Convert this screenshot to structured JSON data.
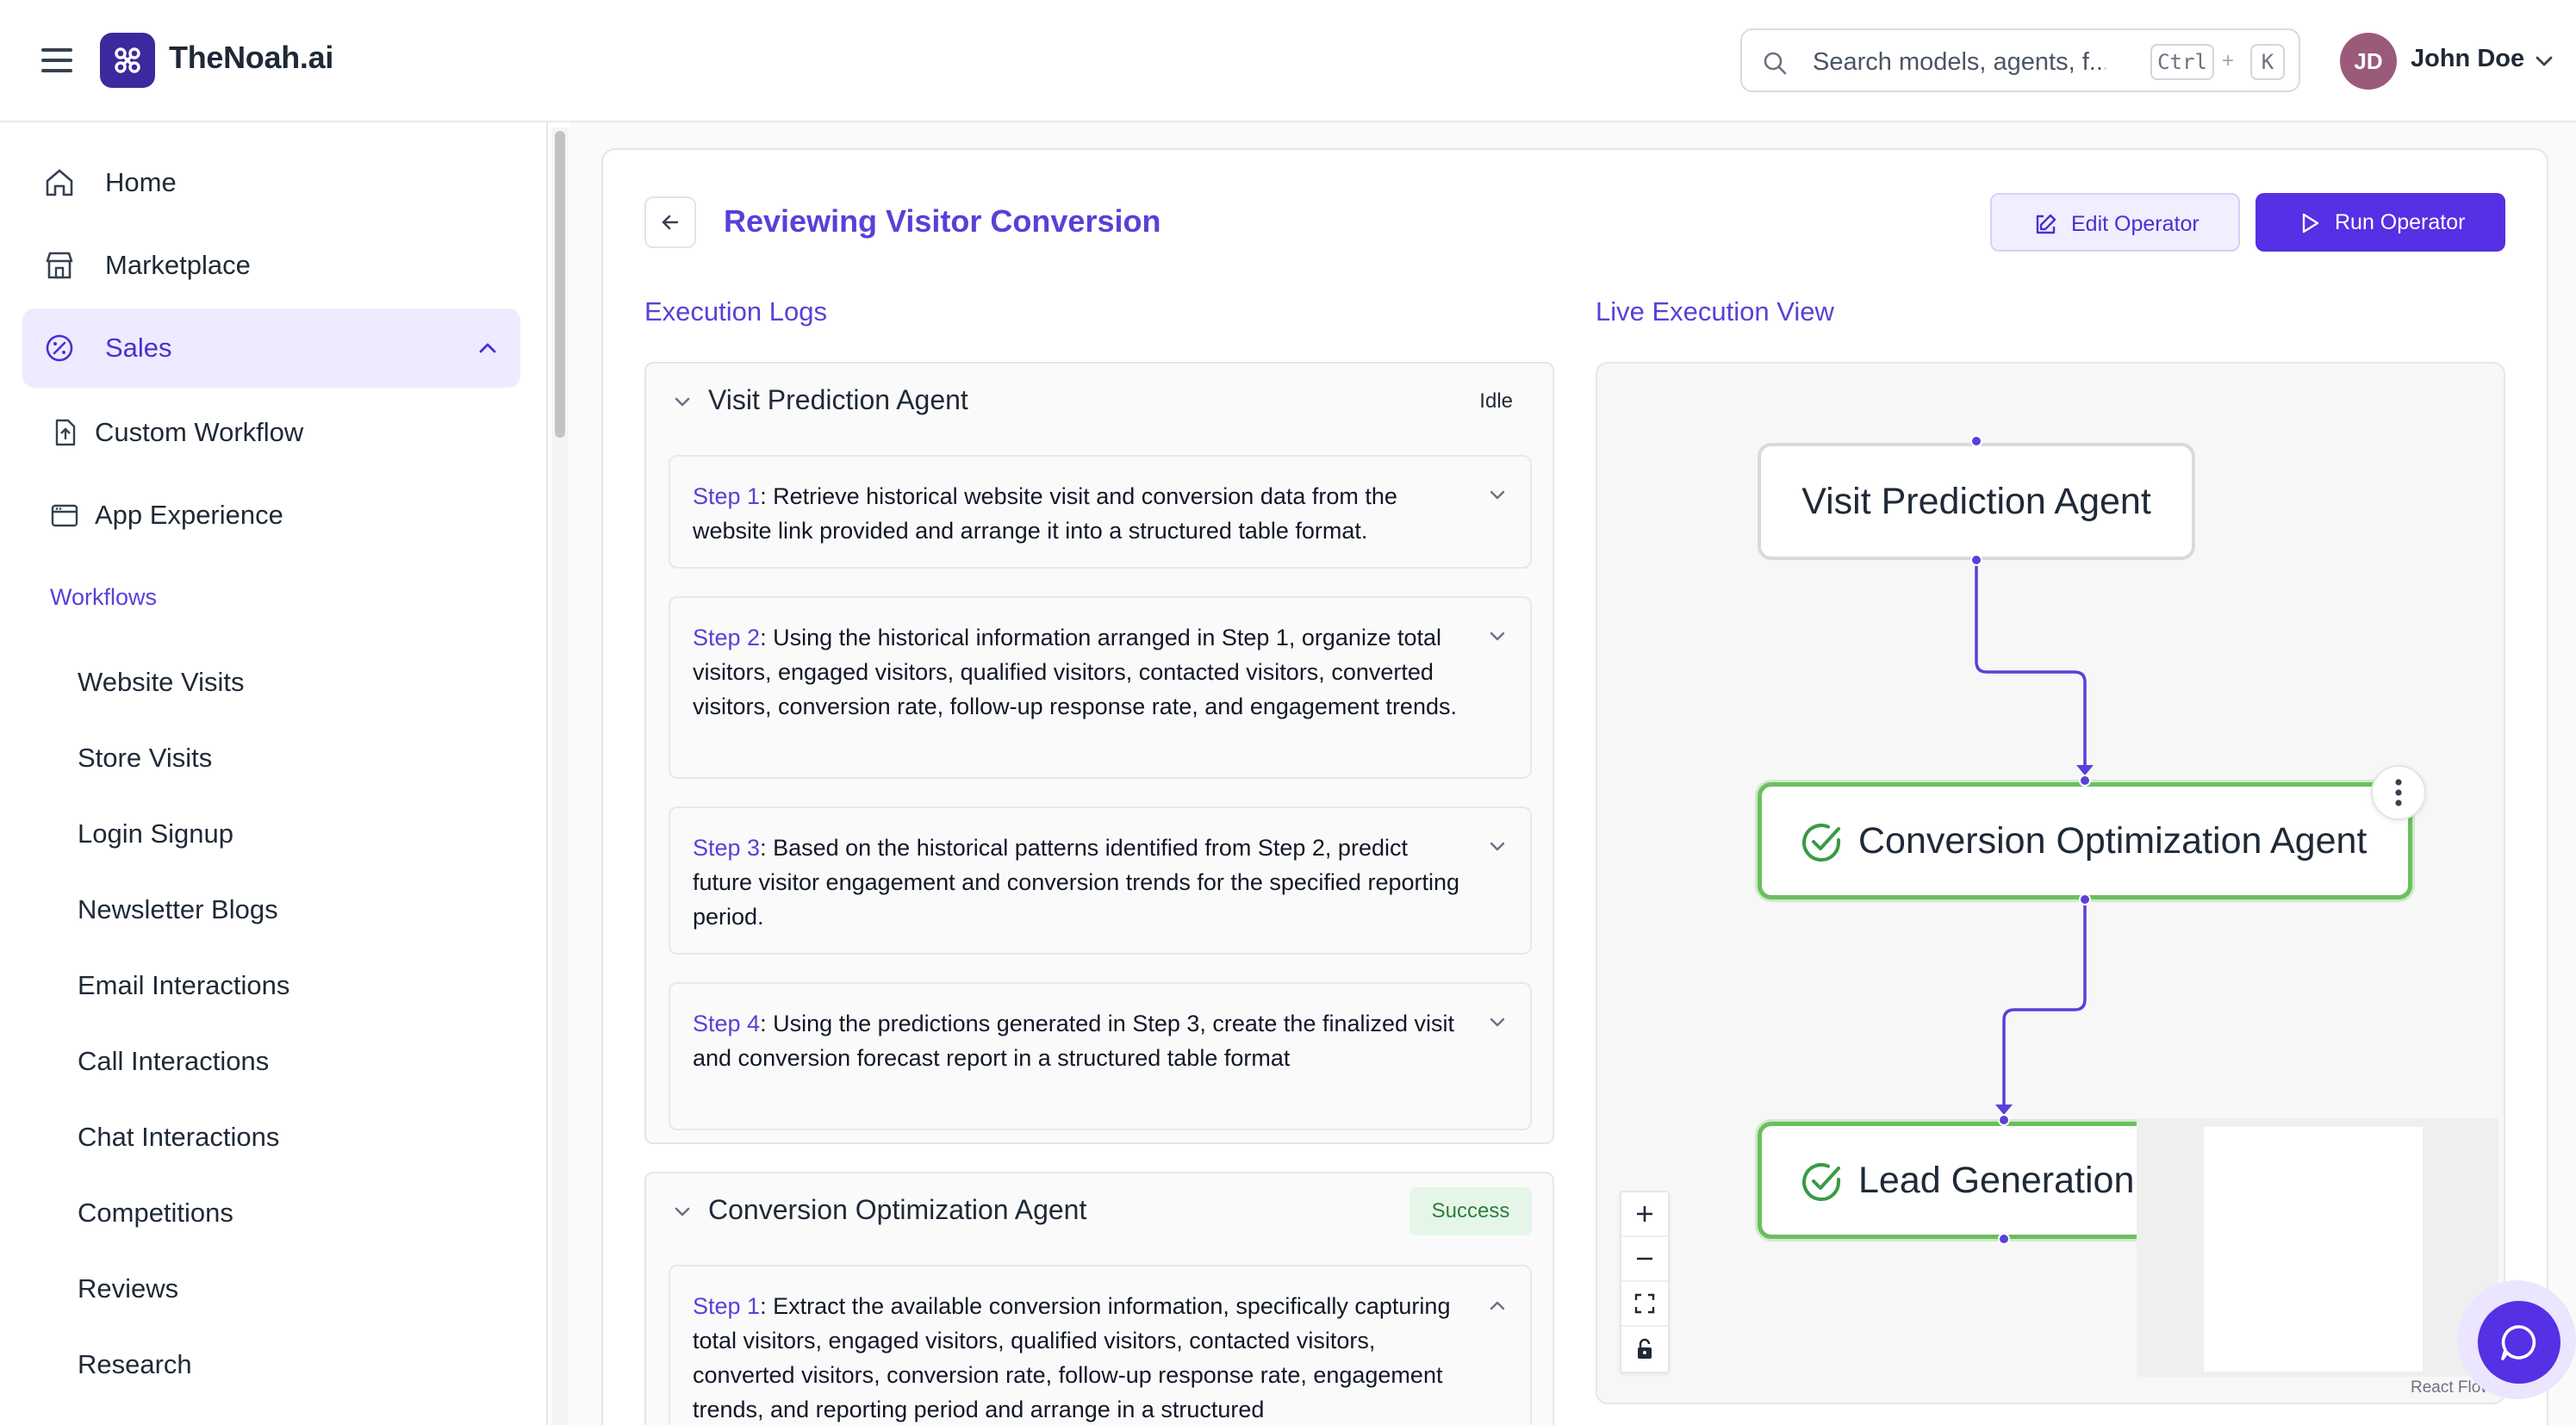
{
  "header": {
    "brand": "TheNoah.ai",
    "search_placeholder": "Search models, agents, f...",
    "shortcut_ctrl": "Ctrl",
    "shortcut_plus": "+",
    "shortcut_key": "K",
    "user_initials": "JD",
    "user_name": "John Doe"
  },
  "sidebar": {
    "items": [
      {
        "label": "Home",
        "icon": "home-icon"
      },
      {
        "label": "Marketplace",
        "icon": "store-icon"
      },
      {
        "label": "Sales",
        "icon": "sales-icon",
        "active": true,
        "expanded": true
      },
      {
        "label": "Custom Workflow",
        "icon": "file-upload-icon"
      },
      {
        "label": "App Experience",
        "icon": "browser-window-icon"
      }
    ],
    "section_title": "Workflows",
    "workflows": [
      "Website Visits",
      "Store Visits",
      "Login Signup",
      "Newsletter Blogs",
      "Email Interactions",
      "Call Interactions",
      "Chat Interactions",
      "Competitions",
      "Reviews",
      "Research"
    ]
  },
  "page": {
    "title": "Reviewing Visitor Conversion",
    "edit_label": "Edit Operator",
    "run_label": "Run Operator",
    "logs_title": "Execution Logs",
    "live_title": "Live Execution View"
  },
  "logs": [
    {
      "agent": "Visit Prediction Agent",
      "status": "Idle",
      "steps": [
        {
          "label": "Step 1",
          "text": ": Retrieve historical website visit and conversion data from the website link provided and arrange it into a structured table format."
        },
        {
          "label": "Step 2",
          "text": ": Using the historical information arranged in Step 1, organize total visitors, engaged visitors, qualified visitors, contacted visitors, converted visitors, conversion rate, follow-up response rate, and engagement trends."
        },
        {
          "label": "Step 3",
          "text": ": Based on the historical patterns identified from Step 2, predict future visitor engagement and conversion trends for the specified reporting period."
        },
        {
          "label": "Step 4",
          "text": ": Using the predictions generated in Step 3, create the finalized visit and conversion forecast report in a structured table format"
        }
      ]
    },
    {
      "agent": "Conversion Optimization Agent",
      "status": "Success",
      "steps": [
        {
          "label": "Step 1",
          "text": ": Extract the available conversion information, specifically capturing total visitors, engaged visitors, qualified visitors, contacted visitors, converted visitors, conversion rate, follow-up response rate, engagement trends, and reporting period and arrange in a structured"
        }
      ]
    }
  ],
  "flow": {
    "nodes": [
      {
        "label": "Visit Prediction Agent",
        "state": "idle"
      },
      {
        "label": "Conversion Optimization Agent",
        "state": "success"
      },
      {
        "label": "Lead Generation",
        "state": "success"
      }
    ],
    "attribution": "React Flow",
    "accent": "#5b3fd8",
    "success_color": "#6bbf5e"
  }
}
